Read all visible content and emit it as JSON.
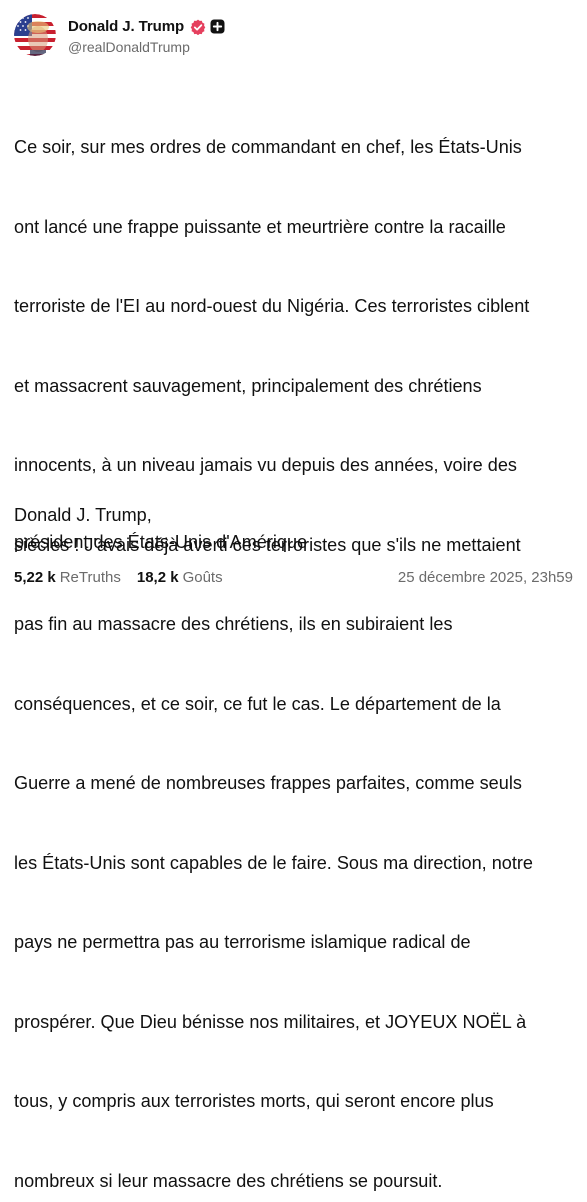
{
  "author": {
    "display_name": "Donald J. Trump",
    "handle": "@realDonaldTrump",
    "verified_icon": "verified-badge-icon",
    "extra_badge_icon": "plus-badge-icon",
    "verified_color": "#e5405e"
  },
  "post": {
    "lines": [
      "Ce soir, sur mes ordres de commandant en chef, les États-Unis",
      "ont lancé une frappe puissante et meurtrière contre la racaille",
      "terroriste de l'EI au nord-ouest du Nigéria. Ces terroristes ciblent",
      "et massacrent sauvagement, principalement des chrétiens",
      "innocents, à un niveau jamais vu depuis des années, voire des",
      "siècles ! J'avais déjà averti ces terroristes que s'ils ne mettaient",
      "pas fin au massacre des chrétiens, ils en subiraient les",
      "conséquences, et ce soir, ce fut le cas. Le département de la",
      "Guerre a mené de nombreuses frappes parfaites, comme seuls",
      "les États-Unis sont capables de le faire. Sous ma direction, notre",
      "pays ne permettra pas au terrorisme islamique radical de",
      "prospérer. Que Dieu bénisse nos militaires, et JOYEUX NOËL à",
      "tous, y compris aux terroristes morts, qui seront encore plus",
      "nombreux si leur massacre des chrétiens se poursuit."
    ],
    "signature_name": "Donald J. Trump,",
    "signature_title": "président des États-Unis d'Amérique"
  },
  "stats": {
    "retruths_count": "5,22 k",
    "retruths_label": "ReTruths",
    "likes_count": "18,2 k",
    "likes_label": "Goûts"
  },
  "timestamp": "25 décembre 2025, 23h59"
}
